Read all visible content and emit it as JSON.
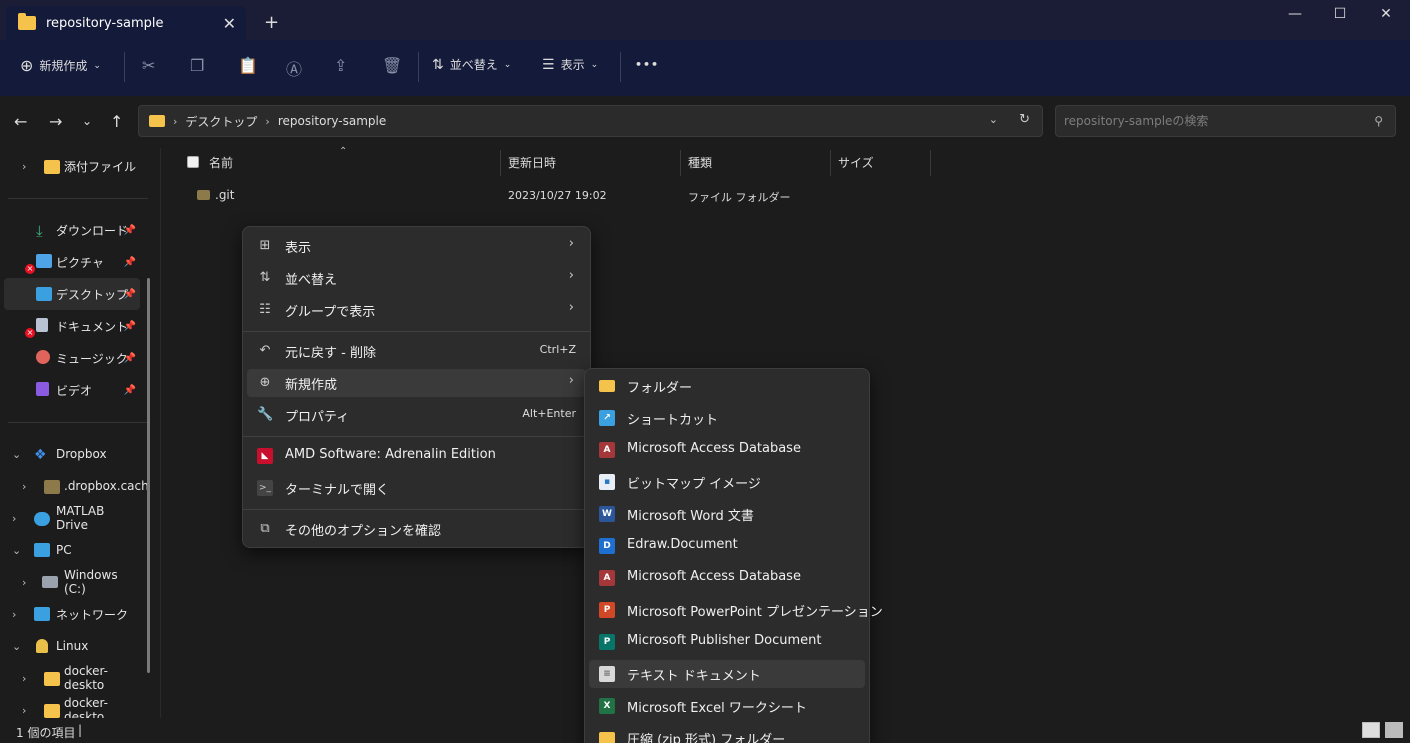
{
  "window": {
    "tab_title": "repository-sample",
    "new_tab": "+",
    "minimize": "—",
    "maximize": "☐",
    "close": "✕"
  },
  "toolbar": {
    "new_label": "新規作成",
    "sort_label": "並べ替え",
    "view_label": "表示",
    "more_label": "•••"
  },
  "address": {
    "crumbs": [
      "デスクトップ",
      "repository-sample"
    ],
    "search_placeholder": "repository-sampleの検索"
  },
  "sidebar": {
    "items": [
      {
        "label": "添付ファイル"
      },
      {
        "label": "ダウンロード"
      },
      {
        "label": "ピクチャ"
      },
      {
        "label": "デスクトップ"
      },
      {
        "label": "ドキュメント"
      },
      {
        "label": "ミュージック"
      },
      {
        "label": "ビデオ"
      },
      {
        "label": "Dropbox"
      },
      {
        "label": ".dropbox.cach"
      },
      {
        "label": "MATLAB Drive"
      },
      {
        "label": "PC"
      },
      {
        "label": "Windows (C:)"
      },
      {
        "label": "ネットワーク"
      },
      {
        "label": "Linux"
      },
      {
        "label": "docker-deskto"
      },
      {
        "label": "docker-deskto"
      }
    ]
  },
  "columns": {
    "name": "名前",
    "modified": "更新日時",
    "type": "種類",
    "size": "サイズ"
  },
  "rows": [
    {
      "name": ".git",
      "modified": "2023/10/27 19:02",
      "type": "ファイル フォルダー",
      "size": ""
    }
  ],
  "context_menu": {
    "items": [
      {
        "label": "表示",
        "shortcut": ""
      },
      {
        "label": "並べ替え",
        "shortcut": ""
      },
      {
        "label": "グループで表示",
        "shortcut": ""
      },
      {
        "label": "元に戻す - 削除",
        "shortcut": "Ctrl+Z"
      },
      {
        "label": "新規作成",
        "shortcut": ""
      },
      {
        "label": "プロパティ",
        "shortcut": "Alt+Enter"
      },
      {
        "label": "AMD Software: Adrenalin Edition",
        "shortcut": ""
      },
      {
        "label": "ターミナルで開く",
        "shortcut": ""
      },
      {
        "label": "その他のオプションを確認",
        "shortcut": ""
      }
    ]
  },
  "submenu": {
    "items": [
      {
        "label": "フォルダー"
      },
      {
        "label": "ショートカット"
      },
      {
        "label": "Microsoft Access Database"
      },
      {
        "label": "ビットマップ イメージ"
      },
      {
        "label": "Microsoft Word 文書"
      },
      {
        "label": "Edraw.Document"
      },
      {
        "label": "Microsoft Access Database"
      },
      {
        "label": "Microsoft PowerPoint プレゼンテーション"
      },
      {
        "label": "Microsoft Publisher Document"
      },
      {
        "label": "テキスト ドキュメント"
      },
      {
        "label": "Microsoft Excel ワークシート"
      },
      {
        "label": "圧縮 (zip 形式) フォルダー"
      }
    ]
  },
  "status": {
    "item_count": "1 個の項目",
    "caret": "|"
  },
  "colors": {
    "titlebar": "#1a1d35",
    "toolbar": "#141a3a",
    "background": "#1c1c1c",
    "menu": "#2c2c2c",
    "folder": "#f5c24c"
  }
}
